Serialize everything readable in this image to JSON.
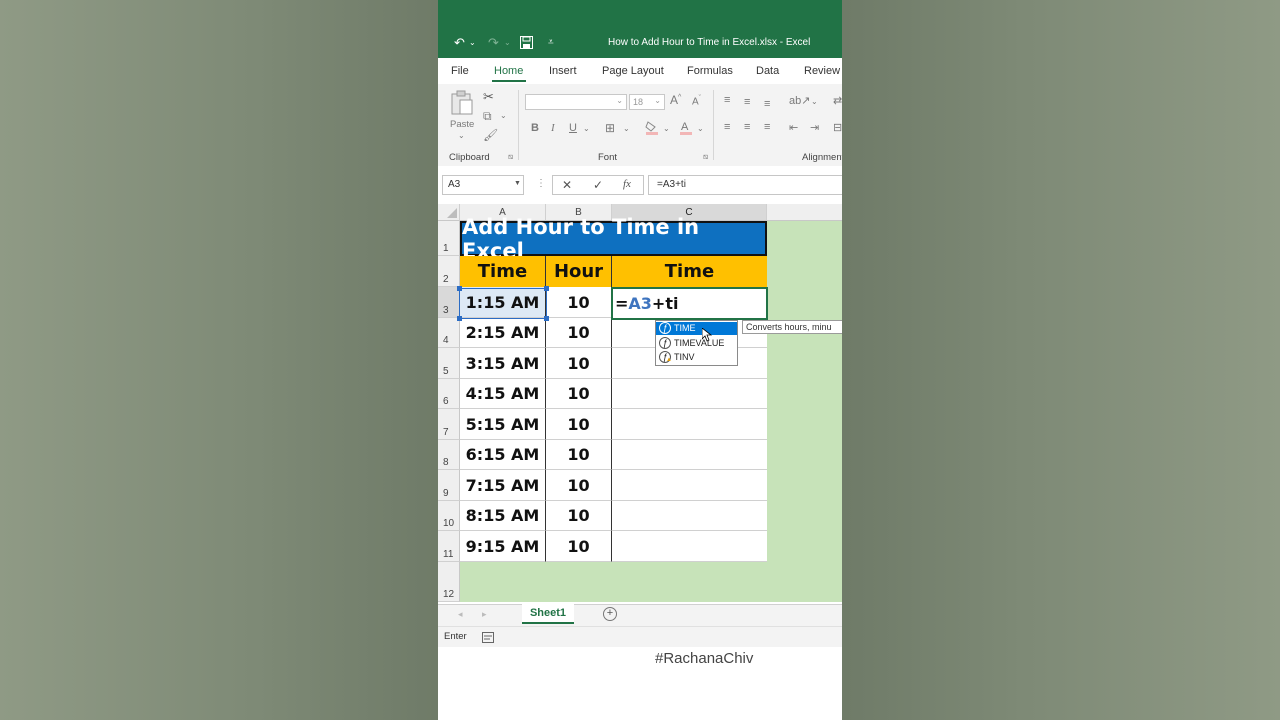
{
  "window": {
    "title": "How to Add Hour to Time in Excel.xlsx  -  Excel"
  },
  "ribbon": {
    "tabs": [
      "File",
      "Home",
      "Insert",
      "Page Layout",
      "Formulas",
      "Data",
      "Review"
    ],
    "active_tab": "Home",
    "groups": [
      "Clipboard",
      "Font",
      "Alignment"
    ],
    "paste_label": "Paste",
    "font_size_value": "18"
  },
  "formula_bar": {
    "name_box": "A3",
    "formula": "=A3+ti"
  },
  "sheet": {
    "columns": [
      "A",
      "B",
      "C"
    ],
    "row_numbers": [
      "1",
      "2",
      "3",
      "4",
      "5",
      "6",
      "7",
      "8",
      "9",
      "10",
      "11",
      "12"
    ],
    "title": "Add Hour to Time in Excel",
    "headers": [
      "Time",
      "Hour",
      "Time"
    ],
    "rows": [
      [
        "1:15 AM",
        "10"
      ],
      [
        "2:15 AM",
        "10"
      ],
      [
        "3:15 AM",
        "10"
      ],
      [
        "4:15 AM",
        "10"
      ],
      [
        "5:15 AM",
        "10"
      ],
      [
        "6:15 AM",
        "10"
      ],
      [
        "7:15 AM",
        "10"
      ],
      [
        "8:15 AM",
        "10"
      ],
      [
        "9:15 AM",
        "10"
      ]
    ],
    "editing_cell": {
      "prefix": "=",
      "ref": "A3",
      "suffix": "+ti"
    }
  },
  "autocomplete": {
    "items": [
      "TIME",
      "TIMEVALUE",
      "TINV"
    ],
    "selected": "TIME",
    "tooltip": "Converts hours, minu"
  },
  "sheet_tabs": {
    "active": "Sheet1"
  },
  "status": {
    "mode": "Enter"
  },
  "watermark": "#RachanaChiv",
  "colors": {
    "excel_green": "#217346",
    "title_fill": "#0e70c0",
    "header_fill": "#ffc000",
    "sheet_bg": "#c7e3b9",
    "ref_blue": "#3e74bf"
  }
}
